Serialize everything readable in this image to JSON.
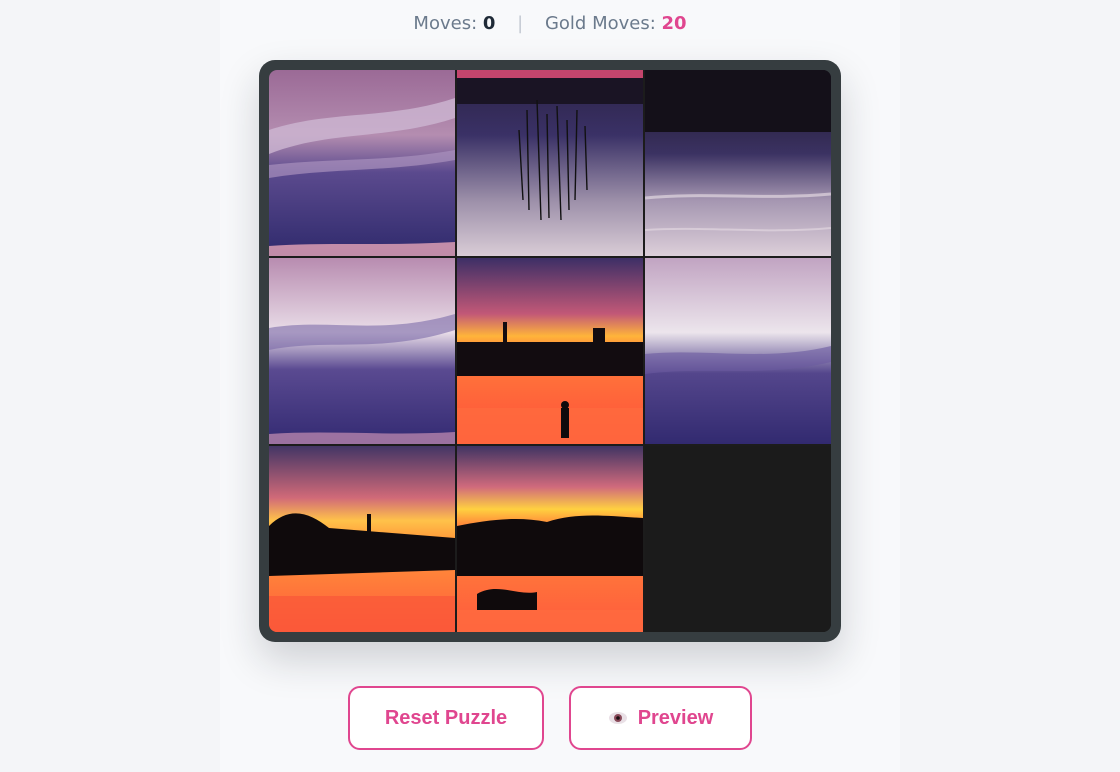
{
  "stats": {
    "moves_label": "Moves:",
    "moves_value": "0",
    "separator": "|",
    "gold_label": "Gold Moves:",
    "gold_value": "20"
  },
  "puzzle": {
    "grid_size": 3,
    "empty_slot": 8
  },
  "buttons": {
    "reset_label": "Reset Puzzle",
    "preview_label": "Preview",
    "preview_icon": "eye-icon"
  },
  "colors": {
    "accent": "#e0468f",
    "board_frame": "#363d40"
  }
}
